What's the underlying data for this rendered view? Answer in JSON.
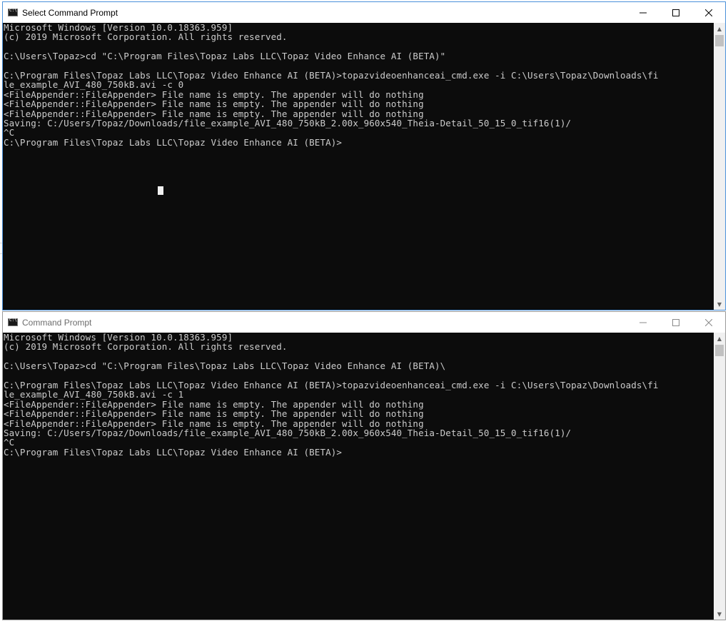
{
  "windows": {
    "top": {
      "title": "Select Command Prompt",
      "console_text": "Microsoft Windows [Version 10.0.18363.959]\n(c) 2019 Microsoft Corporation. All rights reserved.\n\nC:\\Users\\Topaz>cd \"C:\\Program Files\\Topaz Labs LLC\\Topaz Video Enhance AI (BETA)\"\n\nC:\\Program Files\\Topaz Labs LLC\\Topaz Video Enhance AI (BETA)>topazvideoenhanceai_cmd.exe -i C:\\Users\\Topaz\\Downloads\\fi\nle_example_AVI_480_750kB.avi -c 0\n<FileAppender::FileAppender> File name is empty. The appender will do nothing\n<FileAppender::FileAppender> File name is empty. The appender will do nothing\n<FileAppender::FileAppender> File name is empty. The appender will do nothing\nSaving: C:/Users/Topaz/Downloads/file_example_AVI_480_750kB_2.00x_960x540_Theia-Detail_50_15_0_tif16(1)/\n^C\nC:\\Program Files\\Topaz Labs LLC\\Topaz Video Enhance AI (BETA)>"
    },
    "bottom": {
      "title": "Command Prompt",
      "console_text": "Microsoft Windows [Version 10.0.18363.959]\n(c) 2019 Microsoft Corporation. All rights reserved.\n\nC:\\Users\\Topaz>cd \"C:\\Program Files\\Topaz Labs LLC\\Topaz Video Enhance AI (BETA)\\\n\nC:\\Program Files\\Topaz Labs LLC\\Topaz Video Enhance AI (BETA)>topazvideoenhanceai_cmd.exe -i C:\\Users\\Topaz\\Downloads\\fi\nle_example_AVI_480_750kB.avi -c 1\n<FileAppender::FileAppender> File name is empty. The appender will do nothing\n<FileAppender::FileAppender> File name is empty. The appender will do nothing\n<FileAppender::FileAppender> File name is empty. The appender will do nothing\nSaving: C:/Users/Topaz/Downloads/file_example_AVI_480_750kB_2.00x_960x540_Theia-Detail_50_15_0_tif16(1)/\n^C\nC:\\Program Files\\Topaz Labs LLC\\Topaz Video Enhance AI (BETA)>"
    }
  },
  "icons": {
    "app": "cmd-icon",
    "minimize": "minimize-icon",
    "maximize": "maximize-icon",
    "close": "close-icon",
    "scroll_up": "scroll-up-arrow-icon",
    "scroll_down": "scroll-down-arrow-icon"
  },
  "colors": {
    "console_bg": "#0c0c0c",
    "console_fg": "#cccccc",
    "active_border": "#4a90d9"
  }
}
